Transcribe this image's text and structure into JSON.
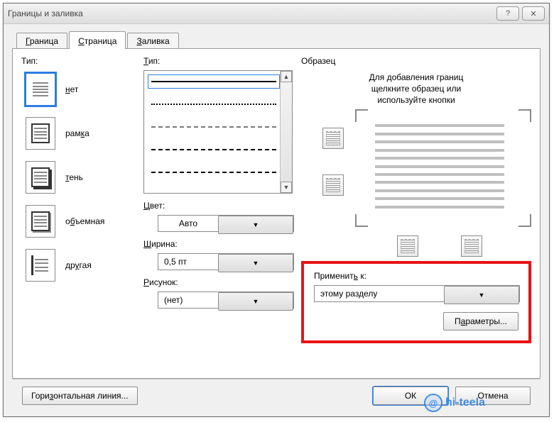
{
  "dialog": {
    "title": "Границы и заливка"
  },
  "tabs": {
    "border": {
      "letter": "Г",
      "rest": "раница"
    },
    "page": {
      "letter": "С",
      "rest": "траница"
    },
    "shading": {
      "letter": "З",
      "rest": "аливка"
    },
    "active_index": 1
  },
  "type_section": {
    "label_b": "Т",
    "label_rest": "ип:",
    "options": [
      {
        "key": "none",
        "label": "нет",
        "underline_index": 0
      },
      {
        "key": "box",
        "label": "рамка",
        "underline_index": 3
      },
      {
        "key": "shadow",
        "label": "тень",
        "underline_index": 0
      },
      {
        "key": "threeD",
        "label": "объемная",
        "underline_index": 1
      },
      {
        "key": "custom",
        "label": "другая",
        "underline_index": 2
      }
    ],
    "selected": "none"
  },
  "style_section": {
    "label_b": "Т",
    "label_rest": "ип:",
    "selected_index": 0
  },
  "color": {
    "label_b": "Ц",
    "label_rest": "вет:",
    "value": "Авто"
  },
  "width": {
    "label_b": "Ш",
    "label_rest": "ирина:",
    "value": "0,5 пт"
  },
  "art": {
    "label_b": "Р",
    "label_rest": "исунок:",
    "value": "(нет)"
  },
  "preview": {
    "title": "Образец",
    "hint1": "Для добавления границ",
    "hint2": "щелкните образец или",
    "hint3": "используйте кнопки"
  },
  "apply": {
    "label_b": "ь",
    "label_pre": "Применит",
    "label_post": " к:",
    "value": "этому разделу",
    "options_btn": "Параметры..."
  },
  "bottom": {
    "hline": "Горизонтальная линия...",
    "ok": "ОК",
    "cancel": "Отмена"
  },
  "watermark": "hi-teela"
}
